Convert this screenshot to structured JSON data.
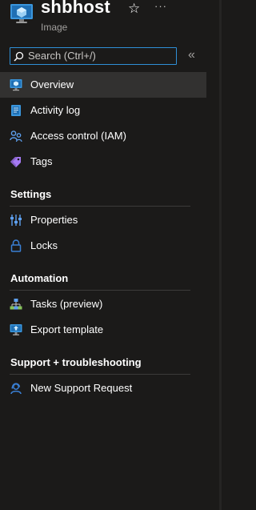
{
  "header": {
    "title": "shbhost",
    "subtitle": "Image",
    "more_label": "···",
    "resource_icon": "vm-image-icon"
  },
  "search": {
    "placeholder": "Search (Ctrl+/)",
    "collapse_label": "«"
  },
  "menu": {
    "items": [
      {
        "label": "Overview",
        "icon": "overview-icon",
        "selected": true
      },
      {
        "label": "Activity log",
        "icon": "activity-log-icon"
      },
      {
        "label": "Access control (IAM)",
        "icon": "iam-people-icon"
      },
      {
        "label": "Tags",
        "icon": "tag-icon"
      }
    ],
    "sections": [
      {
        "title": "Settings",
        "items": [
          {
            "label": "Properties",
            "icon": "properties-sliders-icon"
          },
          {
            "label": "Locks",
            "icon": "lock-icon"
          }
        ]
      },
      {
        "title": "Automation",
        "items": [
          {
            "label": "Tasks (preview)",
            "icon": "tasks-hierarchy-icon"
          },
          {
            "label": "Export template",
            "icon": "export-template-icon"
          }
        ]
      },
      {
        "title": "Support + troubleshooting",
        "items": [
          {
            "label": "New Support Request",
            "icon": "support-person-icon"
          }
        ]
      }
    ]
  },
  "colors": {
    "background": "#1b1a19",
    "selected": "#323130",
    "accent": "#2f8fd6",
    "divider": "#3b3a39"
  }
}
